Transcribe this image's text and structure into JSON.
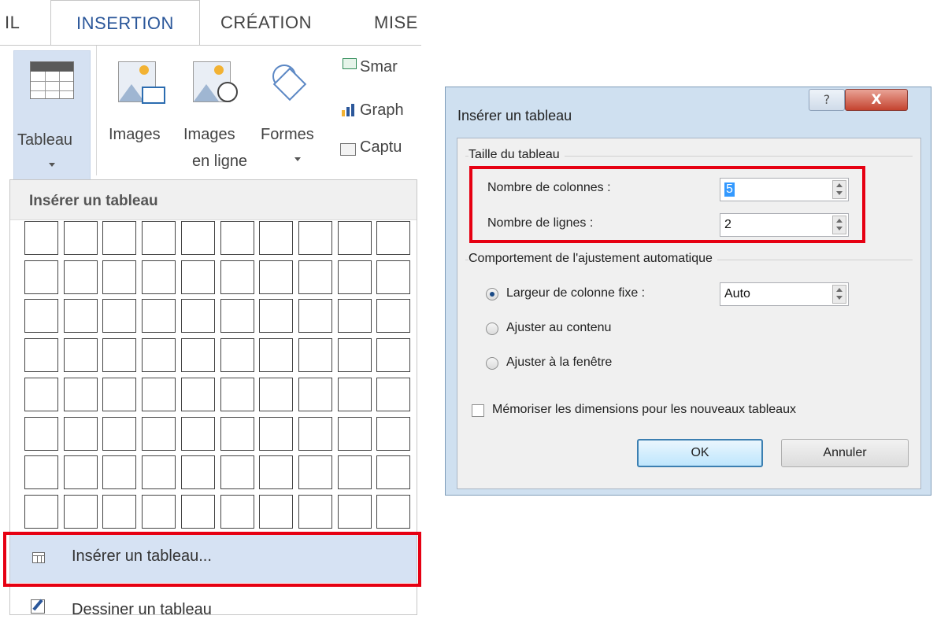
{
  "ribbon": {
    "tabs": [
      {
        "label": "IL"
      },
      {
        "label": "INSERTION"
      },
      {
        "label": "CRÉATION"
      },
      {
        "label": "MISE"
      }
    ],
    "buttons": {
      "tableau": "Tableau",
      "images": "Images",
      "images_en_ligne_1": "Images",
      "images_en_ligne_2": "en ligne",
      "formes": "Formes",
      "smartart": "Smar",
      "graphique": "Graph",
      "capture": "Captu"
    }
  },
  "menu": {
    "header": "Insérer un tableau",
    "grid": {
      "columns": 10,
      "rows": 8
    },
    "items": [
      {
        "label": "Insérer un tableau...",
        "icon": "table-icon",
        "highlighted": true
      },
      {
        "label": "Dessiner un tableau",
        "icon": "pencil-table-icon"
      }
    ]
  },
  "dialog": {
    "title": "Insérer un tableau",
    "help": "?",
    "close": "X",
    "size_section": "Taille du tableau",
    "columns_label": "Nombre de colonnes :",
    "columns_value": "5",
    "rows_label": "Nombre de lignes :",
    "rows_value": "2",
    "autofit_section": "Comportement de l'ajustement automatique",
    "options": [
      {
        "label": "Largeur de colonne fixe :",
        "selected": true
      },
      {
        "label": "Ajuster au contenu",
        "selected": false
      },
      {
        "label": "Ajuster à la fenêtre",
        "selected": false
      }
    ],
    "fixed_width_value": "Auto",
    "remember_label": "Mémoriser les dimensions pour les nouveaux tableaux",
    "remember_checked": false,
    "ok": "OK",
    "cancel": "Annuler"
  },
  "colors": {
    "accent": "#2b579a",
    "highlight": "#d6e2f3",
    "annotation": "#e60012"
  }
}
